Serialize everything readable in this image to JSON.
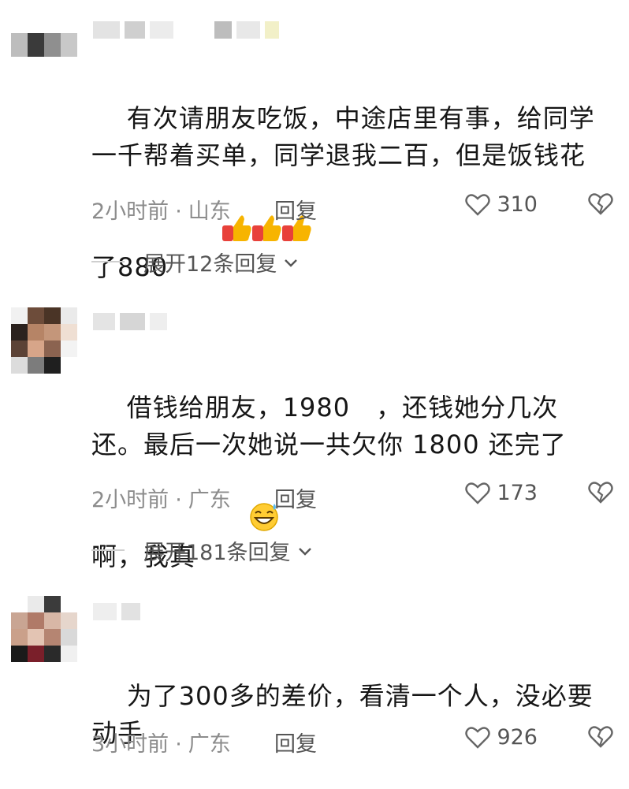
{
  "comments": [
    {
      "text": "有次请朋友吃饭，中途店里有事，给同学一千帮着买单，同学退我二百，但是饭钱花了880",
      "emoji": "thumbs-up-icon x3",
      "time": "2小时前",
      "location": "山东",
      "reply_label": "回复",
      "likes": "310",
      "expand_label": "展开12条回复"
    },
    {
      "text": "借钱给朋友，1980　，还钱她分几次还。最后一次她说一共欠你 1800 还完了啊，我真",
      "emoji": "grinning-sweat-icon",
      "time": "2小时前",
      "location": "广东",
      "reply_label": "回复",
      "likes": "173",
      "expand_label": "展开181条回复"
    },
    {
      "text": "为了300多的差价，看清一个人，没必要动手",
      "time": "3小时前",
      "location": "广东",
      "reply_label": "回复",
      "likes": "926"
    }
  ],
  "colors": {
    "meta": "#8c8c8c",
    "text": "#161616",
    "icon": "#666666"
  }
}
